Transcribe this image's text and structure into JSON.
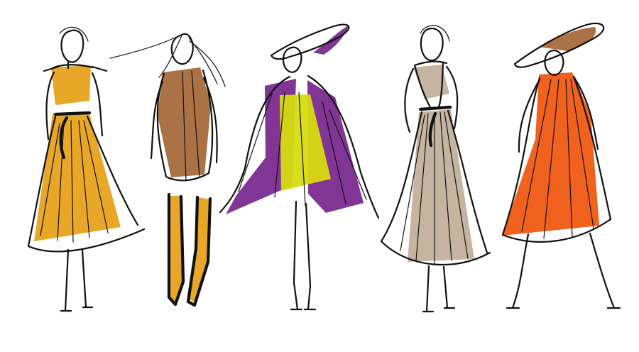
{
  "colors": {
    "background": "#ffffff",
    "ink": "#111111",
    "mustard": "#E7A21A",
    "brown": "#A66A3B",
    "purple": "#7A2A8E",
    "lime": "#D6DB10",
    "taupe": "#C2B19B",
    "orange": "#F05A12"
  },
  "figures": [
    {
      "name": "figure-mustard-dress",
      "color_key": "mustard"
    },
    {
      "name": "figure-brown-coat",
      "color_key": "brown"
    },
    {
      "name": "figure-purple-cape",
      "color_key": "purple"
    },
    {
      "name": "figure-taupe-gown",
      "color_key": "taupe"
    },
    {
      "name": "figure-orange-dress",
      "color_key": "orange"
    }
  ]
}
